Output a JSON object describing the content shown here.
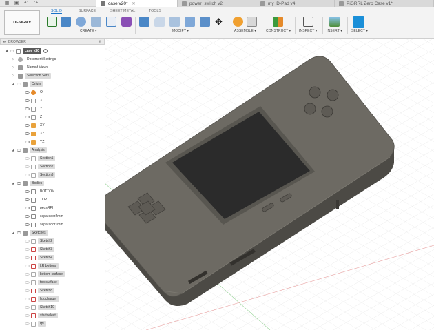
{
  "tabs": [
    {
      "label": "case v20*",
      "active": true
    },
    {
      "label": "power_switch v2",
      "active": false
    },
    {
      "label": "my_D-Pad v4",
      "active": false
    },
    {
      "label": "PiGRRL Zero Case v1*",
      "active": false
    }
  ],
  "ribbon": {
    "design_label": "DESIGN",
    "tabs": [
      "SOLID",
      "SURFACE",
      "SHEET METAL",
      "TOOLS"
    ],
    "groups": [
      "CREATE ▾",
      "MODIFY ▾",
      "ASSEMBLE ▾",
      "CONSTRUCT ▾",
      "INSPECT ▾",
      "INSERT ▾",
      "SELECT ▾"
    ]
  },
  "browser": {
    "header": "BROWSER",
    "root": "case v20",
    "top_items": [
      "Document Settings",
      "Named Views",
      "Selection Sets"
    ],
    "origin": {
      "label": "Origin",
      "items": [
        "O",
        "X",
        "Y",
        "Z",
        "XY",
        "XZ",
        "YZ"
      ]
    },
    "analysis": {
      "label": "Analysis",
      "items": [
        "Section1",
        "Section2",
        "Section3"
      ]
    },
    "bodies": {
      "label": "Bodies",
      "items": [
        "BOTTOM",
        "TOP",
        "pegsRPI",
        "separador2mm",
        "separador1mm"
      ]
    },
    "sketches": {
      "label": "Sketches",
      "items": [
        "Sketch2",
        "Sketch3",
        "Sketch4",
        "LR bottons",
        "bottom surface",
        "top surface",
        "Sketch8",
        "lipocharger",
        "Sketch10",
        "startselect",
        "rpi"
      ]
    }
  },
  "colors": {
    "accent": "#1a73c8",
    "device": "#6d6a63",
    "screen": "#2b2b2b"
  }
}
